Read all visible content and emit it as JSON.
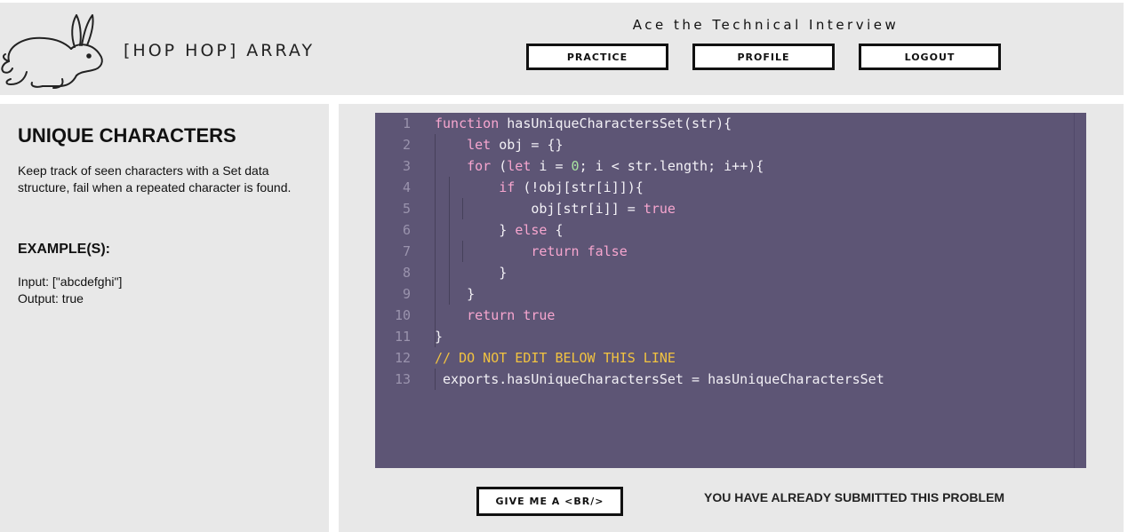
{
  "header": {
    "brand": "[HOP HOP] ARRAY",
    "tagline": "Ace the Technical Interview",
    "nav": {
      "practice": "PRACTICE",
      "profile": "PROFILE",
      "logout": "LOGOUT"
    },
    "logo_icon": "rabbit-icon"
  },
  "problem": {
    "title": "UNIQUE CHARACTERS",
    "description": "Keep track of seen characters with a Set data structure, fail when a repeated character is found.",
    "examples_heading": "EXAMPLE(S):",
    "input_line": "Input: [\"abcdefghi\"]",
    "output_line": "Output: true"
  },
  "editor": {
    "colors": {
      "background": "#5d5575",
      "keyword": "#f7a6cf",
      "number": "#a8e3a0",
      "comment": "#f2c340",
      "text": "#f3f1f6",
      "line_number": "#9a93ad"
    },
    "lines": [
      {
        "n": "1",
        "code": "function hasUniqueCharactersSet(str){"
      },
      {
        "n": "2",
        "code": "    let obj = {}"
      },
      {
        "n": "3",
        "code": "    for (let i = 0; i < str.length; i++){"
      },
      {
        "n": "4",
        "code": "        if (!obj[str[i]]){"
      },
      {
        "n": "5",
        "code": "            obj[str[i]] = true"
      },
      {
        "n": "6",
        "code": "        } else {"
      },
      {
        "n": "7",
        "code": "            return false"
      },
      {
        "n": "8",
        "code": "        }"
      },
      {
        "n": "9",
        "code": "    }"
      },
      {
        "n": "10",
        "code": "    return true"
      },
      {
        "n": "11",
        "code": "}"
      },
      {
        "n": "12",
        "code": "// DO NOT EDIT BELOW THIS LINE"
      },
      {
        "n": "13",
        "code": " exports.hasUniqueCharactersSet = hasUniqueCharactersSet"
      }
    ]
  },
  "actions": {
    "hint_button": "GIVE ME A <BR/>",
    "submitted_message": "YOU HAVE ALREADY SUBMITTED THIS PROBLEM"
  }
}
